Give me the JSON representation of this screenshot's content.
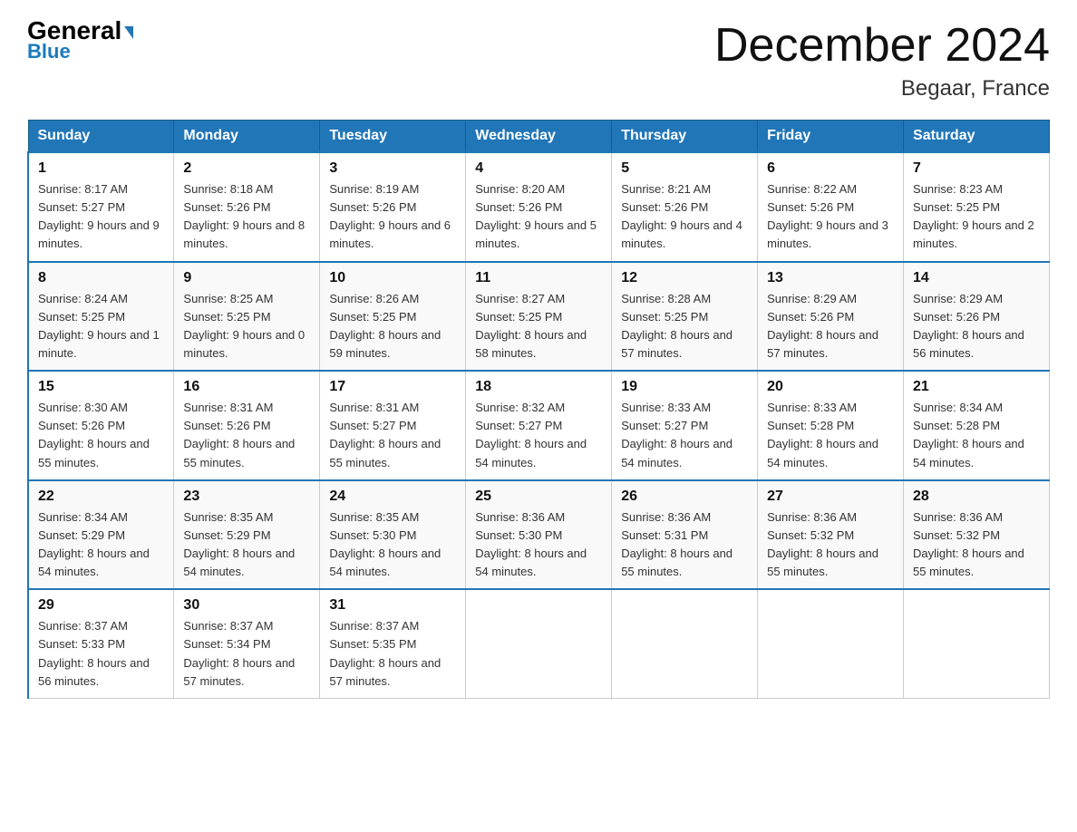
{
  "logo": {
    "general": "General",
    "triangle": "▶",
    "blue": "Blue"
  },
  "title": "December 2024",
  "subtitle": "Begaar, France",
  "days_of_week": [
    "Sunday",
    "Monday",
    "Tuesday",
    "Wednesday",
    "Thursday",
    "Friday",
    "Saturday"
  ],
  "weeks": [
    [
      {
        "num": "1",
        "sunrise": "8:17 AM",
        "sunset": "5:27 PM",
        "daylight": "9 hours and 9 minutes."
      },
      {
        "num": "2",
        "sunrise": "8:18 AM",
        "sunset": "5:26 PM",
        "daylight": "9 hours and 8 minutes."
      },
      {
        "num": "3",
        "sunrise": "8:19 AM",
        "sunset": "5:26 PM",
        "daylight": "9 hours and 6 minutes."
      },
      {
        "num": "4",
        "sunrise": "8:20 AM",
        "sunset": "5:26 PM",
        "daylight": "9 hours and 5 minutes."
      },
      {
        "num": "5",
        "sunrise": "8:21 AM",
        "sunset": "5:26 PM",
        "daylight": "9 hours and 4 minutes."
      },
      {
        "num": "6",
        "sunrise": "8:22 AM",
        "sunset": "5:26 PM",
        "daylight": "9 hours and 3 minutes."
      },
      {
        "num": "7",
        "sunrise": "8:23 AM",
        "sunset": "5:25 PM",
        "daylight": "9 hours and 2 minutes."
      }
    ],
    [
      {
        "num": "8",
        "sunrise": "8:24 AM",
        "sunset": "5:25 PM",
        "daylight": "9 hours and 1 minute."
      },
      {
        "num": "9",
        "sunrise": "8:25 AM",
        "sunset": "5:25 PM",
        "daylight": "9 hours and 0 minutes."
      },
      {
        "num": "10",
        "sunrise": "8:26 AM",
        "sunset": "5:25 PM",
        "daylight": "8 hours and 59 minutes."
      },
      {
        "num": "11",
        "sunrise": "8:27 AM",
        "sunset": "5:25 PM",
        "daylight": "8 hours and 58 minutes."
      },
      {
        "num": "12",
        "sunrise": "8:28 AM",
        "sunset": "5:25 PM",
        "daylight": "8 hours and 57 minutes."
      },
      {
        "num": "13",
        "sunrise": "8:29 AM",
        "sunset": "5:26 PM",
        "daylight": "8 hours and 57 minutes."
      },
      {
        "num": "14",
        "sunrise": "8:29 AM",
        "sunset": "5:26 PM",
        "daylight": "8 hours and 56 minutes."
      }
    ],
    [
      {
        "num": "15",
        "sunrise": "8:30 AM",
        "sunset": "5:26 PM",
        "daylight": "8 hours and 55 minutes."
      },
      {
        "num": "16",
        "sunrise": "8:31 AM",
        "sunset": "5:26 PM",
        "daylight": "8 hours and 55 minutes."
      },
      {
        "num": "17",
        "sunrise": "8:31 AM",
        "sunset": "5:27 PM",
        "daylight": "8 hours and 55 minutes."
      },
      {
        "num": "18",
        "sunrise": "8:32 AM",
        "sunset": "5:27 PM",
        "daylight": "8 hours and 54 minutes."
      },
      {
        "num": "19",
        "sunrise": "8:33 AM",
        "sunset": "5:27 PM",
        "daylight": "8 hours and 54 minutes."
      },
      {
        "num": "20",
        "sunrise": "8:33 AM",
        "sunset": "5:28 PM",
        "daylight": "8 hours and 54 minutes."
      },
      {
        "num": "21",
        "sunrise": "8:34 AM",
        "sunset": "5:28 PM",
        "daylight": "8 hours and 54 minutes."
      }
    ],
    [
      {
        "num": "22",
        "sunrise": "8:34 AM",
        "sunset": "5:29 PM",
        "daylight": "8 hours and 54 minutes."
      },
      {
        "num": "23",
        "sunrise": "8:35 AM",
        "sunset": "5:29 PM",
        "daylight": "8 hours and 54 minutes."
      },
      {
        "num": "24",
        "sunrise": "8:35 AM",
        "sunset": "5:30 PM",
        "daylight": "8 hours and 54 minutes."
      },
      {
        "num": "25",
        "sunrise": "8:36 AM",
        "sunset": "5:30 PM",
        "daylight": "8 hours and 54 minutes."
      },
      {
        "num": "26",
        "sunrise": "8:36 AM",
        "sunset": "5:31 PM",
        "daylight": "8 hours and 55 minutes."
      },
      {
        "num": "27",
        "sunrise": "8:36 AM",
        "sunset": "5:32 PM",
        "daylight": "8 hours and 55 minutes."
      },
      {
        "num": "28",
        "sunrise": "8:36 AM",
        "sunset": "5:32 PM",
        "daylight": "8 hours and 55 minutes."
      }
    ],
    [
      {
        "num": "29",
        "sunrise": "8:37 AM",
        "sunset": "5:33 PM",
        "daylight": "8 hours and 56 minutes."
      },
      {
        "num": "30",
        "sunrise": "8:37 AM",
        "sunset": "5:34 PM",
        "daylight": "8 hours and 57 minutes."
      },
      {
        "num": "31",
        "sunrise": "8:37 AM",
        "sunset": "5:35 PM",
        "daylight": "8 hours and 57 minutes."
      },
      {
        "num": "",
        "sunrise": "",
        "sunset": "",
        "daylight": ""
      },
      {
        "num": "",
        "sunrise": "",
        "sunset": "",
        "daylight": ""
      },
      {
        "num": "",
        "sunrise": "",
        "sunset": "",
        "daylight": ""
      },
      {
        "num": "",
        "sunrise": "",
        "sunset": "",
        "daylight": ""
      }
    ]
  ],
  "labels": {
    "sunrise": "Sunrise:",
    "sunset": "Sunset:",
    "daylight": "Daylight:"
  }
}
